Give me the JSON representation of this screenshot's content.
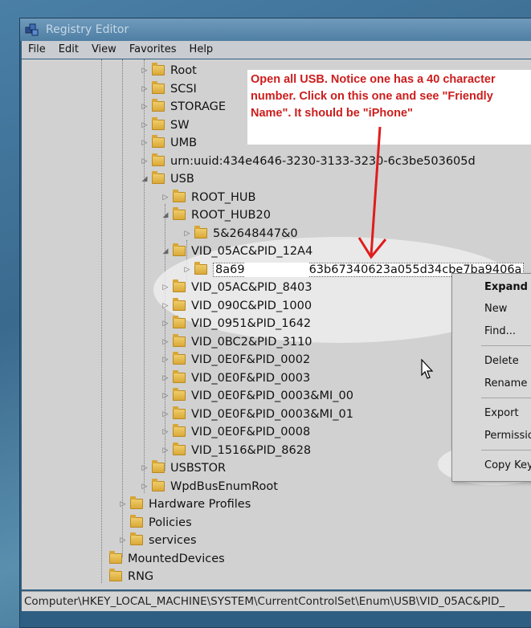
{
  "window": {
    "title": "Registry Editor",
    "icon": "registry-editor-icon"
  },
  "menu": [
    "File",
    "Edit",
    "View",
    "Favorites",
    "Help"
  ],
  "tree": {
    "items": [
      {
        "label": "Root",
        "expander": "▷"
      },
      {
        "label": "SCSI",
        "expander": "▷"
      },
      {
        "label": "STORAGE",
        "expander": "▷"
      },
      {
        "label": "SW",
        "expander": "▷"
      },
      {
        "label": "UMB",
        "expander": "▷"
      },
      {
        "label": "urn:uuid:434e4646-3230-3133-3230-6c3be503605d",
        "expander": "▷"
      },
      {
        "label": "USB",
        "expander": "◢"
      },
      {
        "label": "ROOT_HUB",
        "expander": "▷"
      },
      {
        "label": "ROOT_HUB20",
        "expander": "◢"
      },
      {
        "label": "5&2648447&0",
        "expander": "▷"
      },
      {
        "label": "VID_05AC&PID_12A4",
        "expander": "◢"
      },
      {
        "label_visible_start": "8a69",
        "label_visible_end": "63b67340623a055d34cbe7ba9406a",
        "expander": "▷",
        "selected": true,
        "redacted": true
      },
      {
        "label": "VID_05AC&PID_8403",
        "expander": "▷"
      },
      {
        "label": "VID_090C&PID_1000",
        "expander": "▷"
      },
      {
        "label": "VID_0951&PID_1642",
        "expander": "▷"
      },
      {
        "label": "VID_0BC2&PID_3110",
        "expander": "▷"
      },
      {
        "label": "VID_0E0F&PID_0002",
        "expander": "▷"
      },
      {
        "label": "VID_0E0F&PID_0003",
        "expander": "▷"
      },
      {
        "label": "VID_0E0F&PID_0003&MI_00",
        "expander": "▷"
      },
      {
        "label": "VID_0E0F&PID_0003&MI_01",
        "expander": "▷"
      },
      {
        "label": "VID_0E0F&PID_0008",
        "expander": "▷"
      },
      {
        "label": "VID_1516&PID_8628",
        "expander": "▷"
      },
      {
        "label": "USBSTOR",
        "expander": "▷"
      },
      {
        "label": "WpdBusEnumRoot",
        "expander": "▷"
      },
      {
        "label": "Hardware Profiles",
        "expander": "▷"
      },
      {
        "label": "Policies",
        "expander": ""
      },
      {
        "label": "services",
        "expander": "▷"
      },
      {
        "label": "MountedDevices",
        "expander": ""
      },
      {
        "label": "RNG",
        "expander": ""
      }
    ]
  },
  "context_menu": {
    "items": [
      "Expand",
      "New",
      "Find...",
      "Delete",
      "Rename",
      "Export",
      "Permission",
      "Copy Key"
    ]
  },
  "status": {
    "path": "Computer\\HKEY_LOCAL_MACHINE\\SYSTEM\\CurrentControlSet\\Enum\\USB\\VID_05AC&PID_"
  },
  "annotation": {
    "text": "Open all USB.  Notice one has a 40 character number.  Click on this one and see \"Friendly Name\".  It should be \"iPhone\""
  },
  "colors": {
    "annotation_text": "#cc1d1d",
    "arrow": "#e01c1c",
    "tree_background": "#d1d1d1"
  }
}
